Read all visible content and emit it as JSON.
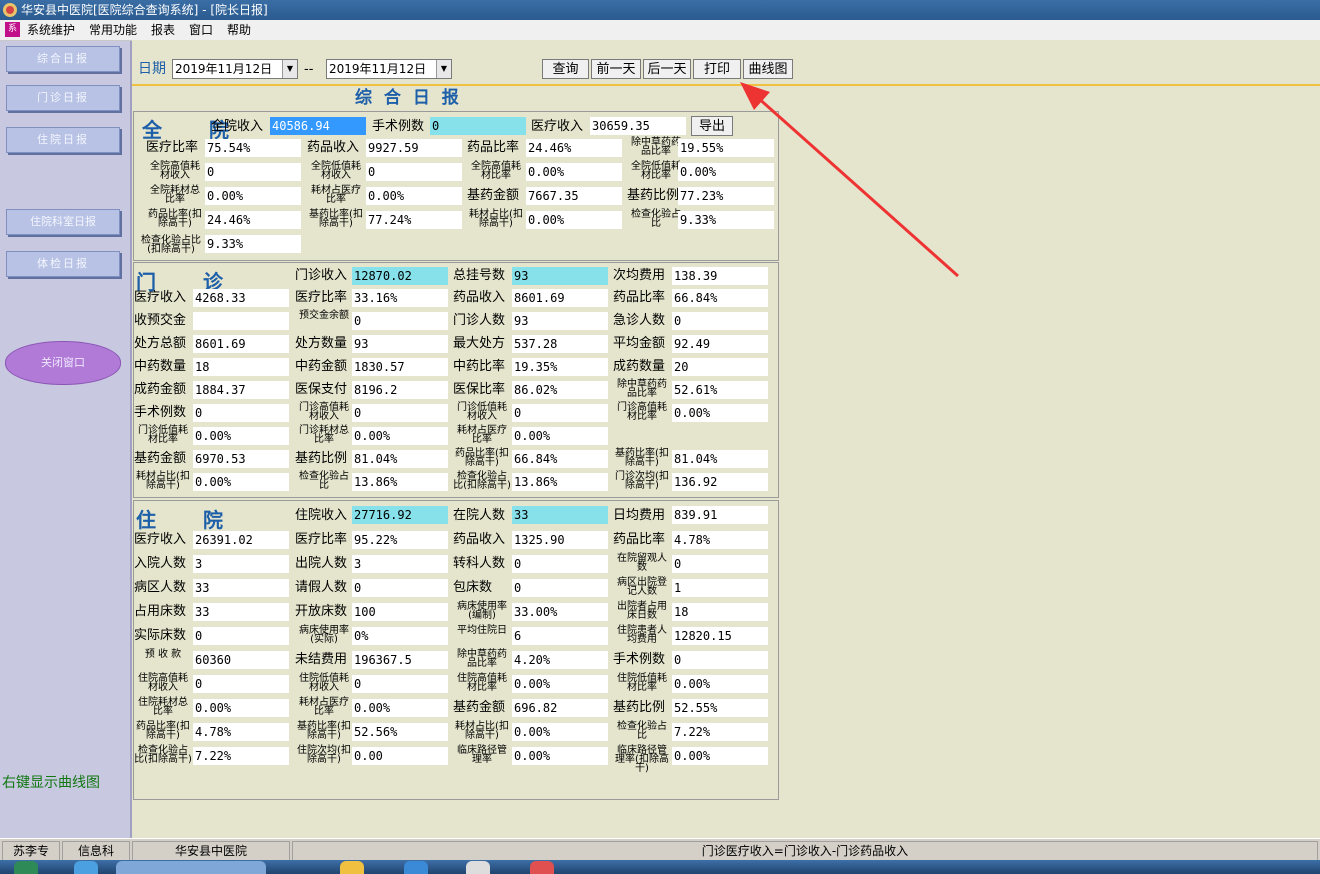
{
  "window": {
    "title": "华安县中医院[医院综合查询系统] - [院长日报]"
  },
  "menu": {
    "items": [
      "系统维护",
      "常用功能",
      "报表",
      "窗口",
      "帮助"
    ]
  },
  "sidebar": {
    "buttons": [
      "综合日报",
      "门诊日报",
      "住院日报",
      "住院科室日报",
      "体检日报"
    ],
    "oval": "关闭窗口",
    "hint": "右键显示曲线图"
  },
  "header": {
    "big_title": [
      "院",
      "长",
      "日",
      "报"
    ],
    "date_label": "日期",
    "date_from": "2019年11月12日",
    "date_sep": "--",
    "date_to": "2019年11月12日",
    "buttons": {
      "query": "查询",
      "prev": "前一天",
      "next": "后一天",
      "print": "打印",
      "chart": "曲线图"
    },
    "report_title": "综 合 日 报"
  },
  "whole": {
    "title": "全  院",
    "row0": [
      {
        "label": "全院收入",
        "value": "40586.94"
      },
      {
        "label": "手术例数",
        "value": "0"
      },
      {
        "label": "医疗收入",
        "value": "30659.35"
      }
    ],
    "export": "导出",
    "rows": [
      [
        "医疗比率",
        "75.54%",
        "药品收入",
        "9927.59",
        "药品比率",
        "24.46%",
        "除中草药药品比率",
        "19.55%"
      ],
      [
        "全院高值耗材收入",
        "0",
        "全院低值耗材收入",
        "0",
        "全院高值耗材比率",
        "0.00%",
        "全院低值耗材比率",
        "0.00%"
      ],
      [
        "全院耗材总比率",
        "0.00%",
        "耗材占医疗比率",
        "0.00%",
        "基药金额",
        "7667.35",
        "基药比例",
        "77.23%"
      ],
      [
        "药品比率(扣除高干)",
        "24.46%",
        "基药比率(扣除高干)",
        "77.24%",
        "耗材占比(扣除高干)",
        "0.00%",
        "检查化验占比",
        "9.33%"
      ]
    ],
    "last": [
      "检查化验占比(扣除高干)",
      "9.33%"
    ]
  },
  "outpatient": {
    "title": "门  诊",
    "row0": [
      {
        "label": "门诊收入",
        "value": "12870.02"
      },
      {
        "label": "总挂号数",
        "value": "93"
      },
      {
        "label": "次均费用",
        "value": "138.39"
      }
    ],
    "rows": [
      [
        "医疗收入",
        "4268.33",
        "医疗比率",
        "33.16%",
        "药品收入",
        "8601.69",
        "药品比率",
        "66.84%"
      ],
      [
        "收预交金",
        "",
        "预交金余额",
        "0",
        "门诊人数",
        "93",
        "急诊人数",
        "0"
      ],
      [
        "处方总额",
        "8601.69",
        "处方数量",
        "93",
        "最大处方",
        "537.28",
        "平均金额",
        "92.49"
      ],
      [
        "中药数量",
        "18",
        "中药金额",
        "1830.57",
        "中药比率",
        "19.35%",
        "成药数量",
        "20"
      ],
      [
        "成药金额",
        "1884.37",
        "医保支付",
        "8196.2",
        "医保比率",
        "86.02%",
        "除中草药药品比率",
        "52.61%"
      ],
      [
        "手术例数",
        "0",
        "门诊高值耗材收入",
        "0",
        "门诊低值耗材收入",
        "0",
        "门诊高值耗材比率",
        "0.00%"
      ],
      [
        "门诊低值耗材比率",
        "0.00%",
        "门诊耗材总比率",
        "0.00%",
        "耗材占医疗比率",
        "0.00%",
        "",
        ""
      ],
      [
        "基药金额",
        "6970.53",
        "基药比例",
        "81.04%",
        "药品比率(扣除高干)",
        "66.84%",
        "基药比率(扣除高干)",
        "81.04%"
      ],
      [
        "耗材占比(扣除高干)",
        "0.00%",
        "检查化验占比",
        "13.86%",
        "检查化验占比(扣除高干)",
        "13.86%",
        "门诊次均(扣除高干)",
        "136.92"
      ]
    ]
  },
  "inpatient": {
    "title": "住  院",
    "row0": [
      {
        "label": "住院收入",
        "value": "27716.92"
      },
      {
        "label": "在院人数",
        "value": "33"
      },
      {
        "label": "日均费用",
        "value": "839.91"
      }
    ],
    "rows": [
      [
        "医疗收入",
        "26391.02",
        "医疗比率",
        "95.22%",
        "药品收入",
        "1325.90",
        "药品比率",
        "4.78%"
      ],
      [
        "入院人数",
        "3",
        "出院人数",
        "3",
        "转科人数",
        "0",
        "在院留观人数",
        "0"
      ],
      [
        "病区人数",
        "33",
        "请假人数",
        "0",
        "包床数",
        "0",
        "病区出院登记人数",
        "1"
      ],
      [
        "占用床数",
        "33",
        "开放床数",
        "100",
        "病床使用率(编制)",
        "33.00%",
        "出院者占用床日数",
        "18"
      ],
      [
        "实际床数",
        "0",
        "病床使用率(实际)",
        "0%",
        "平均住院日",
        "6",
        "住院患者人均费用",
        "12820.15"
      ],
      [
        "预 收 款",
        "60360",
        "未结费用",
        "196367.5",
        "除中草药药品比率",
        "4.20%",
        "手术例数",
        "0"
      ],
      [
        "住院高值耗材收入",
        "0",
        "住院低值耗材收入",
        "0",
        "住院高值耗材比率",
        "0.00%",
        "住院低值耗材比率",
        "0.00%"
      ],
      [
        "住院耗材总比率",
        "0.00%",
        "耗材占医疗比率",
        "0.00%",
        "基药金额",
        "696.82",
        "基药比例",
        "52.55%"
      ],
      [
        "药品比率(扣除高干)",
        "4.78%",
        "基药比率(扣除高干)",
        "52.56%",
        "耗材占比(扣除高干)",
        "0.00%",
        "检查化验占比",
        "7.22%"
      ],
      [
        "检查化验占比(扣除高干)",
        "7.22%",
        "住院次均(扣除高干)",
        "0.00",
        "临床路径管理率",
        "0.00%",
        "临床路径管理率(扣除高干)",
        "0.00%"
      ]
    ]
  },
  "status": {
    "user": "苏李专",
    "dept": "信息科",
    "hospital": "华安县中医院",
    "message": "门诊医疗收入=门诊收入-门诊药品收入"
  },
  "colors": {
    "accent_blue": "#1d5fa8",
    "cyan_field": "#86e1ea",
    "arrow": "#ee3333",
    "panel_bg": "#e5e5ce"
  }
}
